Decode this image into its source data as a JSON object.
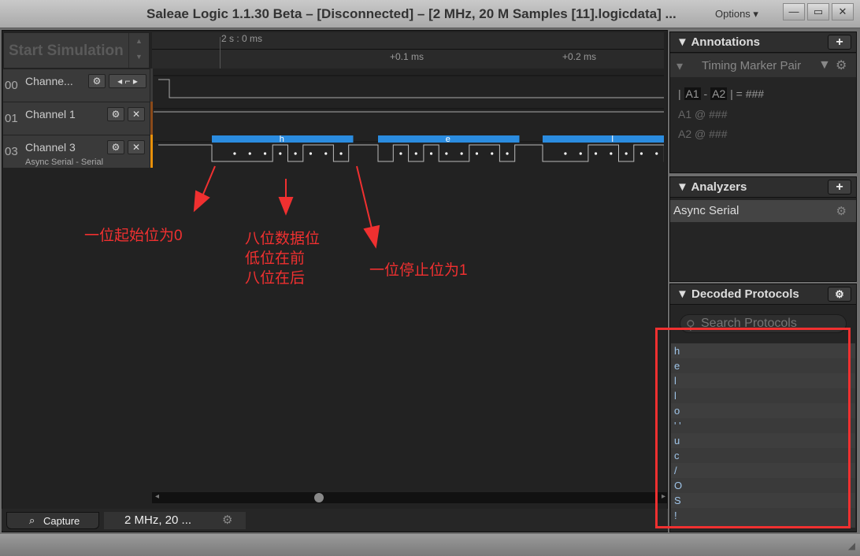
{
  "window": {
    "title": "Saleae Logic 1.1.30 Beta – [Disconnected] – [2 MHz, 20 M Samples [11].logicdata] ...",
    "options": "Options ▾"
  },
  "toolbar": {
    "start_simulation": "Start Simulation"
  },
  "timeline": {
    "origin": "2 s : 0 ms",
    "ticks": [
      "+0.1 ms",
      "+0.2 ms"
    ]
  },
  "channels": [
    {
      "num": "00",
      "name": "Channe...",
      "color": "#3a3a3a"
    },
    {
      "num": "01",
      "name": "Channel 1",
      "color": "#8a4a1a"
    },
    {
      "num": "03",
      "name": "Channel 3",
      "sub": "Async Serial - Serial",
      "color": "#e8900a"
    }
  ],
  "decoded_frames": [
    "h",
    "e",
    "l"
  ],
  "frame_color": "#2b8ce0",
  "annotations_overlay": {
    "start": "一位起始位为0",
    "data": [
      "八位数据位",
      "低位在前",
      "八位在后"
    ],
    "stop": "一位停止位为1",
    "color": "#f03030"
  },
  "bottom": {
    "capture_tab": "Capture",
    "session_tab": "2 MHz, 20 ..."
  },
  "right": {
    "annotations": {
      "title": "Annotations",
      "marker": "Timing Marker Pair",
      "formula": [
        "|",
        "A1",
        "-",
        "A2",
        "|",
        "=",
        "###"
      ],
      "a1": "A1  @  ###",
      "a2": "A2  @  ###"
    },
    "analyzers": {
      "title": "Analyzers",
      "items": [
        "Async Serial"
      ]
    },
    "decoded": {
      "title": "Decoded Protocols",
      "search_placeholder": "Search Protocols",
      "rows": [
        "h",
        "e",
        "l",
        "l",
        "o",
        "' '",
        "u",
        "c",
        "/",
        "O",
        "S",
        "!"
      ]
    }
  }
}
